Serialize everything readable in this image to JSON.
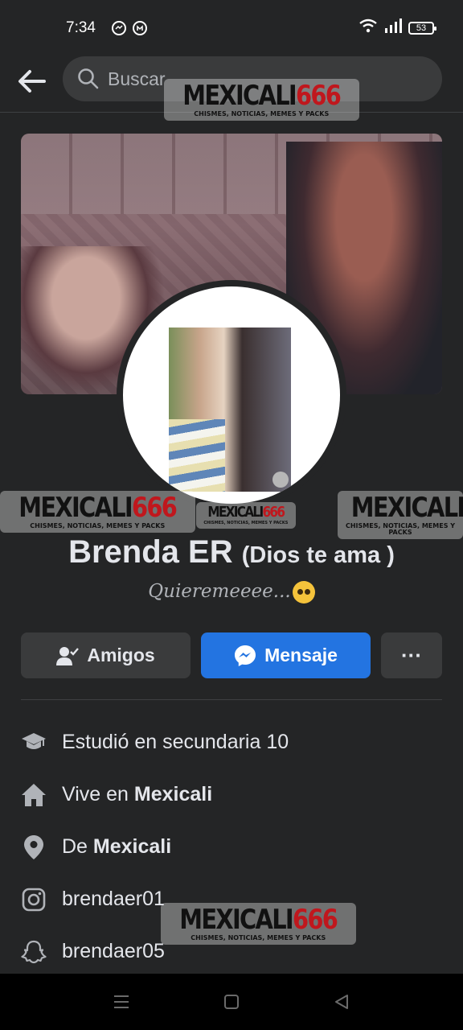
{
  "status_bar": {
    "time": "7:34",
    "battery": "53"
  },
  "search": {
    "placeholder": "Buscar"
  },
  "watermark": {
    "main": "MEXICALI",
    "number": "666",
    "sub": "CHISMES, NOTICIAS, MEMES Y PACKS"
  },
  "profile": {
    "name": "Brenda ER",
    "alternate_name": "(Dios te ama )",
    "bio": "Quieremeeee..."
  },
  "actions": {
    "friends": "Amigos",
    "message": "Mensaje",
    "more": "···"
  },
  "details": {
    "study": {
      "text": "Estudió en secundaria 10",
      "icon": "graduation-cap-icon"
    },
    "lives_prefix": "Vive en ",
    "lives_city": "Mexicali",
    "from_prefix": "De ",
    "from_city": "Mexicali",
    "instagram": "brendaer01",
    "snapchat": "brendaer05"
  },
  "colors": {
    "background": "#242526",
    "accent_blue": "#2374e1",
    "button_gray": "#3a3b3c",
    "watermark_red": "#c0171d"
  }
}
